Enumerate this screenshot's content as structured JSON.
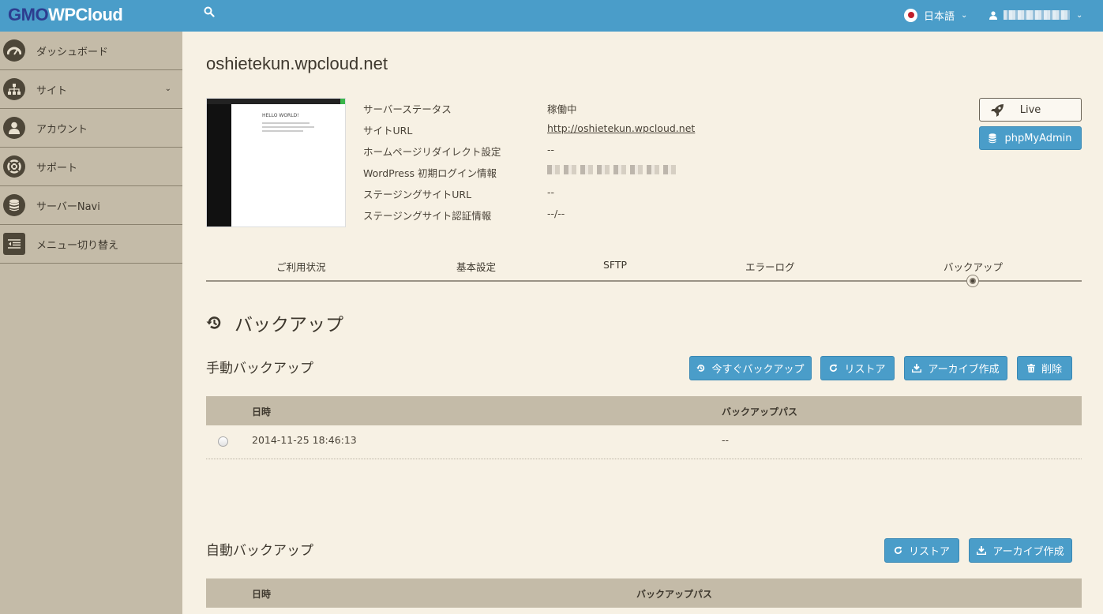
{
  "topbar": {
    "logo_main": "GMO",
    "logo_accent": "WPCloud",
    "language": "日本語",
    "user_name": ""
  },
  "sidebar": {
    "items": [
      {
        "label": "ダッシュボード",
        "icon": "dashboard-icon"
      },
      {
        "label": "サイト",
        "icon": "sitemap-icon"
      },
      {
        "label": "アカウント",
        "icon": "user-icon"
      },
      {
        "label": "サポート",
        "icon": "lifebuoy-icon"
      },
      {
        "label": "サーバーNavi",
        "icon": "database-icon"
      },
      {
        "label": "メニュー切り替え",
        "icon": "menu-toggle-icon"
      }
    ]
  },
  "site": {
    "title": "oshietekun.wpcloud.net",
    "thumbnail": {
      "brand": "GMO WP Cloud",
      "heading": "HELLO WORLD!"
    },
    "info": [
      {
        "label": "サーバーステータス",
        "value": "稼働中"
      },
      {
        "label": "サイトURL",
        "value": "http://oshietekun.wpcloud.net"
      },
      {
        "label": "ホームページリダイレクト設定",
        "value": "--"
      },
      {
        "label": "WordPress 初期ログイン情報",
        "value": ""
      },
      {
        "label": "ステージングサイトURL",
        "value": "--"
      },
      {
        "label": "ステージングサイト認証情報",
        "value": "--/--"
      }
    ],
    "live_button": "Live",
    "pma_button": "phpMyAdmin"
  },
  "tabs": [
    {
      "label": "ご利用状況"
    },
    {
      "label": "基本設定"
    },
    {
      "label": "SFTP"
    },
    {
      "label": "エラーログ"
    },
    {
      "label": "バックアップ",
      "active": true
    }
  ],
  "backup": {
    "title": "バックアップ",
    "manual": {
      "title": "手動バックアップ",
      "buttons": {
        "backup_now": "今すぐバックアップ",
        "restore": "リストア",
        "archive": "アーカイブ作成",
        "delete": "削除"
      },
      "columns": {
        "datetime": "日時",
        "path": "バックアップパス"
      },
      "rows": [
        {
          "datetime": "2014-11-25 18:46:13",
          "path": "--"
        }
      ]
    },
    "auto": {
      "title": "自動バックアップ",
      "buttons": {
        "restore": "リストア",
        "archive": "アーカイブ作成"
      },
      "columns": {
        "datetime": "日時",
        "path": "バックアップパス"
      }
    }
  },
  "colors": {
    "topbar": "#4a9dc9",
    "sidebar": "#c4bba8",
    "background": "#f7f1e4",
    "button": "#4a9dc9"
  }
}
